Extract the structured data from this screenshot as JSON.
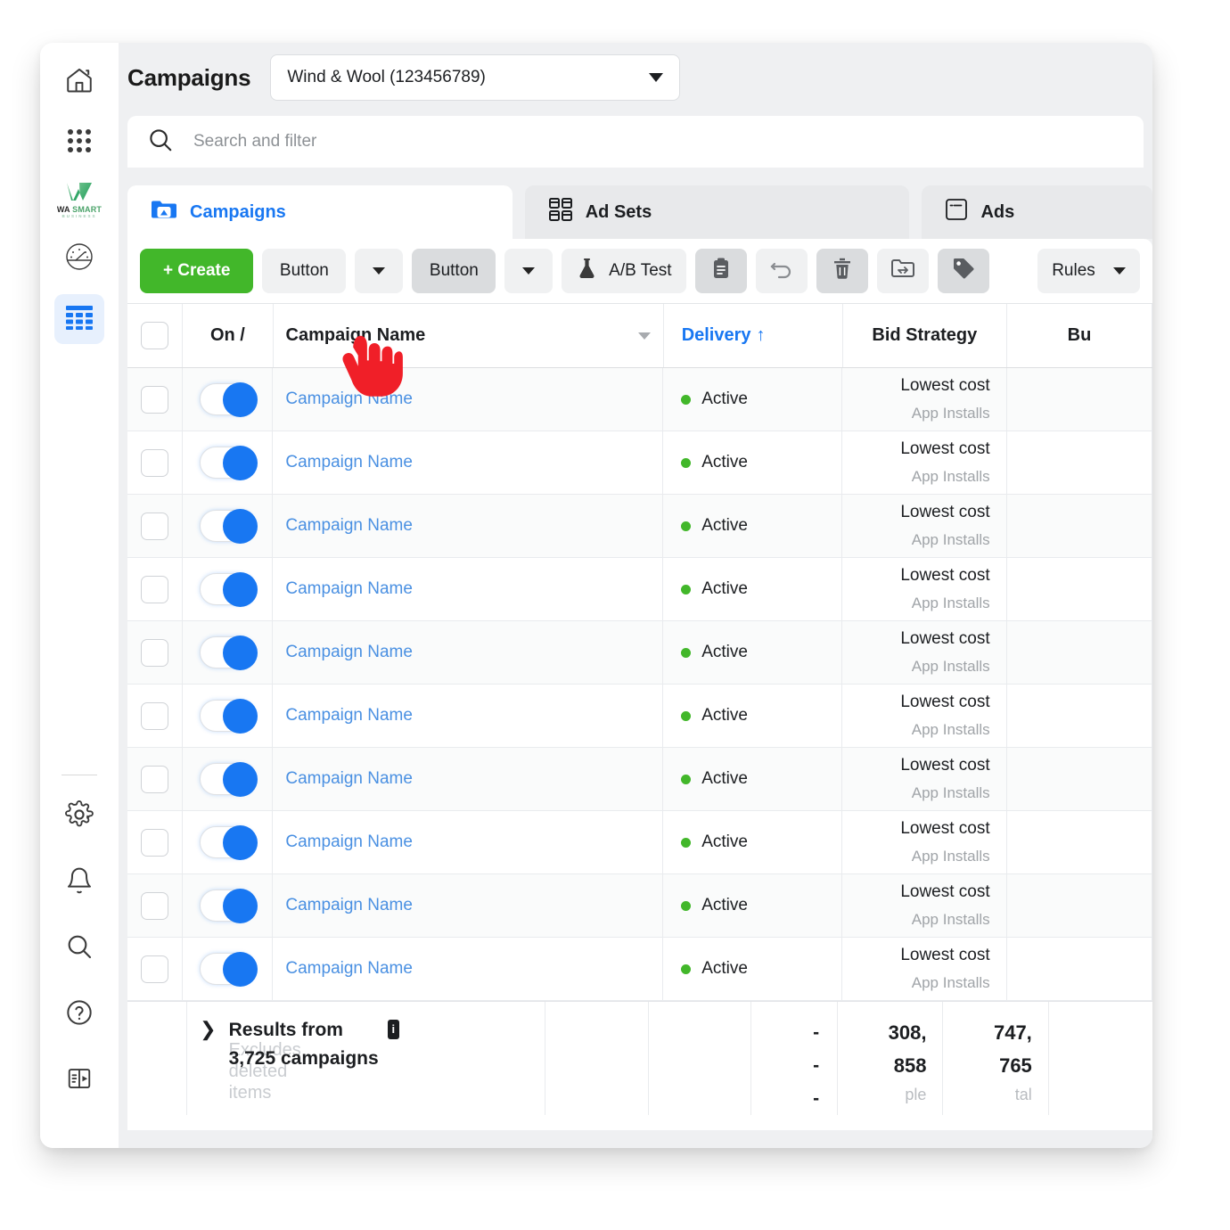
{
  "header": {
    "title": "Campaigns",
    "account": "Wind & Wool (123456789)"
  },
  "search": {
    "placeholder": "Search and filter"
  },
  "tabs": [
    {
      "label": "Campaigns",
      "icon": "campaigns-folder-icon",
      "active": true
    },
    {
      "label": "Ad Sets",
      "icon": "ad-sets-grid-icon",
      "active": false
    },
    {
      "label": "Ads",
      "icon": "ads-card-icon",
      "active": false
    }
  ],
  "toolbar": {
    "create_label": "+ Create",
    "button1_label": "Button",
    "button2_label": "Button",
    "ab_test_label": "A/B Test",
    "rules_label": "Rules",
    "icons": [
      "duplicate-icon",
      "undo-icon",
      "delete-icon",
      "move-folder-icon",
      "tag-icon"
    ]
  },
  "table": {
    "columns": [
      {
        "key": "check",
        "label": ""
      },
      {
        "key": "toggle",
        "label": "On /"
      },
      {
        "key": "name",
        "label": "Campaign Name"
      },
      {
        "key": "delivery",
        "label": "Delivery",
        "sort": "↑"
      },
      {
        "key": "bid",
        "label": "Bid Strategy"
      },
      {
        "key": "budget",
        "label": "Bu"
      }
    ],
    "rows": [
      {
        "name": "Campaign Name",
        "delivery": "Active",
        "bid": "Lowest cost",
        "bid_sub": "App Installs"
      },
      {
        "name": "Campaign Name",
        "delivery": "Active",
        "bid": "Lowest cost",
        "bid_sub": "App Installs"
      },
      {
        "name": "Campaign Name",
        "delivery": "Active",
        "bid": "Lowest cost",
        "bid_sub": "App Installs"
      },
      {
        "name": "Campaign Name",
        "delivery": "Active",
        "bid": "Lowest cost",
        "bid_sub": "App Installs"
      },
      {
        "name": "Campaign Name",
        "delivery": "Active",
        "bid": "Lowest cost",
        "bid_sub": "App Installs"
      },
      {
        "name": "Campaign Name",
        "delivery": "Active",
        "bid": "Lowest cost",
        "bid_sub": "App Installs"
      },
      {
        "name": "Campaign Name",
        "delivery": "Active",
        "bid": "Lowest cost",
        "bid_sub": "App Installs"
      },
      {
        "name": "Campaign Name",
        "delivery": "Active",
        "bid": "Lowest cost",
        "bid_sub": "App Installs"
      },
      {
        "name": "Campaign Name",
        "delivery": "Active",
        "bid": "Lowest cost",
        "bid_sub": "App Installs"
      },
      {
        "name": "Campaign Name",
        "delivery": "Active",
        "bid": "Lowest cost",
        "bid_sub": "App Installs"
      }
    ],
    "summary": {
      "title": "Results from",
      "subtitle": "3,725 campaigns",
      "faded_line1": "Excludes",
      "faded_line2": "deleted",
      "faded_line3": "items",
      "info_badge": "i",
      "dash1": "-",
      "dash2": "-",
      "dash3": "-",
      "col1_num1": "308,",
      "col1_num2": "858",
      "col1_sub": "ple",
      "col2_num1": "747,",
      "col2_num2": "765",
      "col2_sub": "tal"
    }
  },
  "sidebar": {
    "items": [
      {
        "name": "home",
        "icon": "home-icon"
      },
      {
        "name": "apps",
        "icon": "grid-apps-icon"
      },
      {
        "name": "logo",
        "icon": "wa-smart-logo"
      },
      {
        "name": "analytics",
        "icon": "speedometer-icon"
      },
      {
        "name": "table",
        "icon": "table-grid-icon",
        "active": true
      }
    ],
    "bottom_items": [
      {
        "name": "settings",
        "icon": "gear-icon"
      },
      {
        "name": "notifications",
        "icon": "bell-icon"
      },
      {
        "name": "search",
        "icon": "search-icon"
      },
      {
        "name": "help",
        "icon": "question-circle-icon"
      },
      {
        "name": "panel",
        "icon": "side-panel-icon"
      }
    ]
  },
  "logo": {
    "line1a": "WA ",
    "line1b": "SMART",
    "line2": "BUSINESS"
  },
  "colors": {
    "accent_blue": "#1877f2",
    "link_blue": "#4a90e2",
    "green": "#42b72a",
    "cursor_red": "#f01f28"
  }
}
